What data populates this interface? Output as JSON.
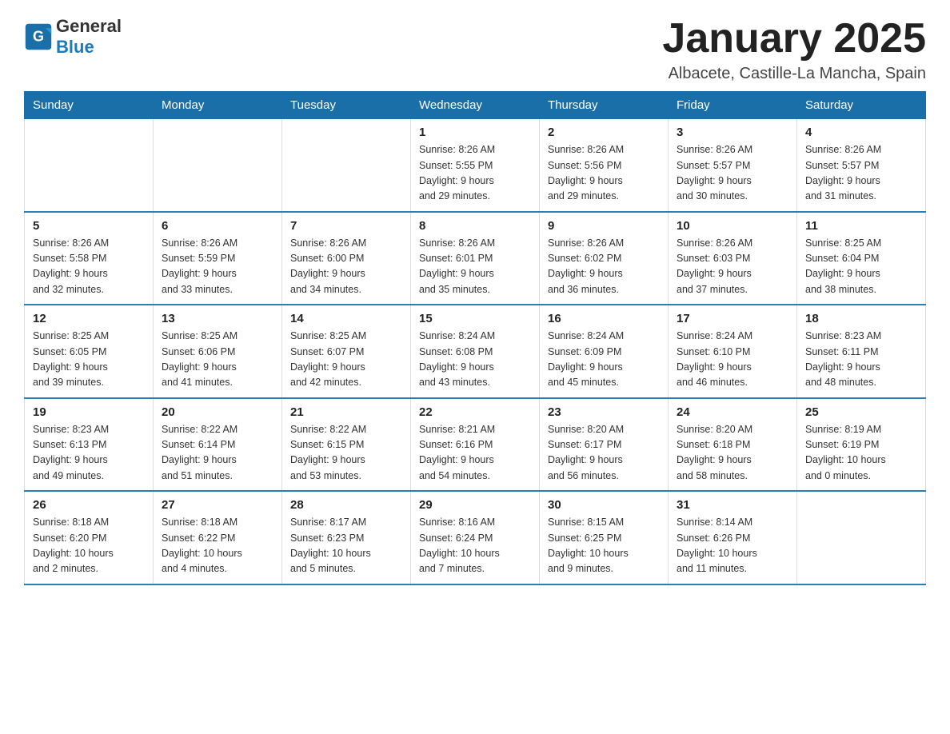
{
  "header": {
    "logo_text_general": "General",
    "logo_text_blue": "Blue",
    "month_title": "January 2025",
    "location": "Albacete, Castille-La Mancha, Spain"
  },
  "days_of_week": [
    "Sunday",
    "Monday",
    "Tuesday",
    "Wednesday",
    "Thursday",
    "Friday",
    "Saturday"
  ],
  "weeks": [
    [
      {
        "day": "",
        "info": ""
      },
      {
        "day": "",
        "info": ""
      },
      {
        "day": "",
        "info": ""
      },
      {
        "day": "1",
        "info": "Sunrise: 8:26 AM\nSunset: 5:55 PM\nDaylight: 9 hours\nand 29 minutes."
      },
      {
        "day": "2",
        "info": "Sunrise: 8:26 AM\nSunset: 5:56 PM\nDaylight: 9 hours\nand 29 minutes."
      },
      {
        "day": "3",
        "info": "Sunrise: 8:26 AM\nSunset: 5:57 PM\nDaylight: 9 hours\nand 30 minutes."
      },
      {
        "day": "4",
        "info": "Sunrise: 8:26 AM\nSunset: 5:57 PM\nDaylight: 9 hours\nand 31 minutes."
      }
    ],
    [
      {
        "day": "5",
        "info": "Sunrise: 8:26 AM\nSunset: 5:58 PM\nDaylight: 9 hours\nand 32 minutes."
      },
      {
        "day": "6",
        "info": "Sunrise: 8:26 AM\nSunset: 5:59 PM\nDaylight: 9 hours\nand 33 minutes."
      },
      {
        "day": "7",
        "info": "Sunrise: 8:26 AM\nSunset: 6:00 PM\nDaylight: 9 hours\nand 34 minutes."
      },
      {
        "day": "8",
        "info": "Sunrise: 8:26 AM\nSunset: 6:01 PM\nDaylight: 9 hours\nand 35 minutes."
      },
      {
        "day": "9",
        "info": "Sunrise: 8:26 AM\nSunset: 6:02 PM\nDaylight: 9 hours\nand 36 minutes."
      },
      {
        "day": "10",
        "info": "Sunrise: 8:26 AM\nSunset: 6:03 PM\nDaylight: 9 hours\nand 37 minutes."
      },
      {
        "day": "11",
        "info": "Sunrise: 8:25 AM\nSunset: 6:04 PM\nDaylight: 9 hours\nand 38 minutes."
      }
    ],
    [
      {
        "day": "12",
        "info": "Sunrise: 8:25 AM\nSunset: 6:05 PM\nDaylight: 9 hours\nand 39 minutes."
      },
      {
        "day": "13",
        "info": "Sunrise: 8:25 AM\nSunset: 6:06 PM\nDaylight: 9 hours\nand 41 minutes."
      },
      {
        "day": "14",
        "info": "Sunrise: 8:25 AM\nSunset: 6:07 PM\nDaylight: 9 hours\nand 42 minutes."
      },
      {
        "day": "15",
        "info": "Sunrise: 8:24 AM\nSunset: 6:08 PM\nDaylight: 9 hours\nand 43 minutes."
      },
      {
        "day": "16",
        "info": "Sunrise: 8:24 AM\nSunset: 6:09 PM\nDaylight: 9 hours\nand 45 minutes."
      },
      {
        "day": "17",
        "info": "Sunrise: 8:24 AM\nSunset: 6:10 PM\nDaylight: 9 hours\nand 46 minutes."
      },
      {
        "day": "18",
        "info": "Sunrise: 8:23 AM\nSunset: 6:11 PM\nDaylight: 9 hours\nand 48 minutes."
      }
    ],
    [
      {
        "day": "19",
        "info": "Sunrise: 8:23 AM\nSunset: 6:13 PM\nDaylight: 9 hours\nand 49 minutes."
      },
      {
        "day": "20",
        "info": "Sunrise: 8:22 AM\nSunset: 6:14 PM\nDaylight: 9 hours\nand 51 minutes."
      },
      {
        "day": "21",
        "info": "Sunrise: 8:22 AM\nSunset: 6:15 PM\nDaylight: 9 hours\nand 53 minutes."
      },
      {
        "day": "22",
        "info": "Sunrise: 8:21 AM\nSunset: 6:16 PM\nDaylight: 9 hours\nand 54 minutes."
      },
      {
        "day": "23",
        "info": "Sunrise: 8:20 AM\nSunset: 6:17 PM\nDaylight: 9 hours\nand 56 minutes."
      },
      {
        "day": "24",
        "info": "Sunrise: 8:20 AM\nSunset: 6:18 PM\nDaylight: 9 hours\nand 58 minutes."
      },
      {
        "day": "25",
        "info": "Sunrise: 8:19 AM\nSunset: 6:19 PM\nDaylight: 10 hours\nand 0 minutes."
      }
    ],
    [
      {
        "day": "26",
        "info": "Sunrise: 8:18 AM\nSunset: 6:20 PM\nDaylight: 10 hours\nand 2 minutes."
      },
      {
        "day": "27",
        "info": "Sunrise: 8:18 AM\nSunset: 6:22 PM\nDaylight: 10 hours\nand 4 minutes."
      },
      {
        "day": "28",
        "info": "Sunrise: 8:17 AM\nSunset: 6:23 PM\nDaylight: 10 hours\nand 5 minutes."
      },
      {
        "day": "29",
        "info": "Sunrise: 8:16 AM\nSunset: 6:24 PM\nDaylight: 10 hours\nand 7 minutes."
      },
      {
        "day": "30",
        "info": "Sunrise: 8:15 AM\nSunset: 6:25 PM\nDaylight: 10 hours\nand 9 minutes."
      },
      {
        "day": "31",
        "info": "Sunrise: 8:14 AM\nSunset: 6:26 PM\nDaylight: 10 hours\nand 11 minutes."
      },
      {
        "day": "",
        "info": ""
      }
    ]
  ]
}
